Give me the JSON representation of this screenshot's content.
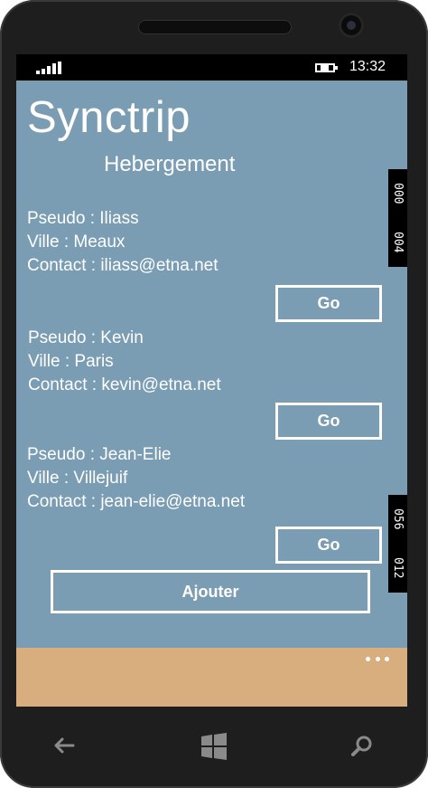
{
  "status": {
    "time": "13:32"
  },
  "app": {
    "title": "Synctrip",
    "subtitle": "Hebergement"
  },
  "entries": [
    {
      "pseudo": "Pseudo : Iliass",
      "ville": "Ville : Meaux",
      "contact": "Contact : iliass@etna.net",
      "button": "Go"
    },
    {
      "pseudo": "Pseudo : Kevin",
      "ville": "Ville : Paris",
      "contact": "Contact : kevin@etna.net",
      "button": "Go"
    },
    {
      "pseudo": "Pseudo : Jean-Elie",
      "ville": "Ville : Villejuif",
      "contact": "Contact : jean-elie@etna.net",
      "button": "Go"
    }
  ],
  "add_button": "Ajouter",
  "debug_counters": {
    "top": [
      "000",
      "004"
    ],
    "bottom": [
      "056",
      "012"
    ]
  },
  "icons": {
    "signal": "signal-strength-icon",
    "battery": "battery-charging-icon",
    "more": "more-ellipsis-icon",
    "back": "back-arrow-icon",
    "start": "windows-start-icon",
    "search": "search-icon"
  },
  "colors": {
    "page_background": "#7a9db3",
    "app_bar": "#d8ae7e",
    "text": "#ffffff"
  }
}
